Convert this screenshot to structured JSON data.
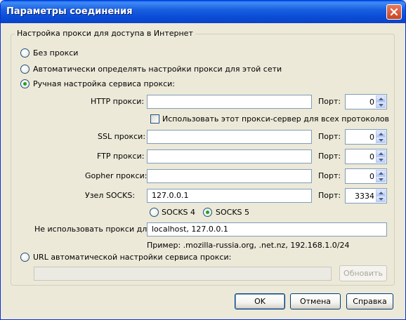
{
  "window": {
    "title": "Параметры соединения"
  },
  "group": {
    "legend": "Настройка прокси для доступа в Интернет"
  },
  "options": {
    "no_proxy": "Без прокси",
    "auto_detect": "Автоматически определять настройки прокси для этой сети",
    "manual": "Ручная настройка сервиса прокси:",
    "auto_url": "URL автоматической настройки сервиса прокси:"
  },
  "manual": {
    "http_label": "HTTP прокси:",
    "http_value": "",
    "http_port": "0",
    "use_for_all": "Использовать этот прокси-сервер для всех протоколов",
    "ssl_label": "SSL прокси:",
    "ssl_value": "",
    "ssl_port": "0",
    "ftp_label": "FTP прокси:",
    "ftp_value": "",
    "ftp_port": "0",
    "gopher_label": "Gopher прокси:",
    "gopher_value": "",
    "gopher_port": "0",
    "socks_label": "Узел SOCKS:",
    "socks_value": "127.0.0.1",
    "socks_port": "3334",
    "port_label": "Порт:",
    "socks4": "SOCKS 4",
    "socks5": "SOCKS 5",
    "no_proxy_for_label": "Не использовать прокси для:",
    "no_proxy_for_value": "localhost, 127.0.0.1",
    "example": "Пример: .mozilla-russia.org, .net.nz, 192.168.1.0/24"
  },
  "auto_url": {
    "value": "",
    "reload_label": "Обновить"
  },
  "buttons": {
    "ok": "OK",
    "cancel": "Отмена",
    "help": "Справка"
  },
  "state": {
    "selected_mode": "manual",
    "socks_version": "5",
    "use_for_all": false
  },
  "icons": {
    "close": "close-icon",
    "spin_up": "spin-up-icon",
    "spin_down": "spin-down-icon"
  }
}
